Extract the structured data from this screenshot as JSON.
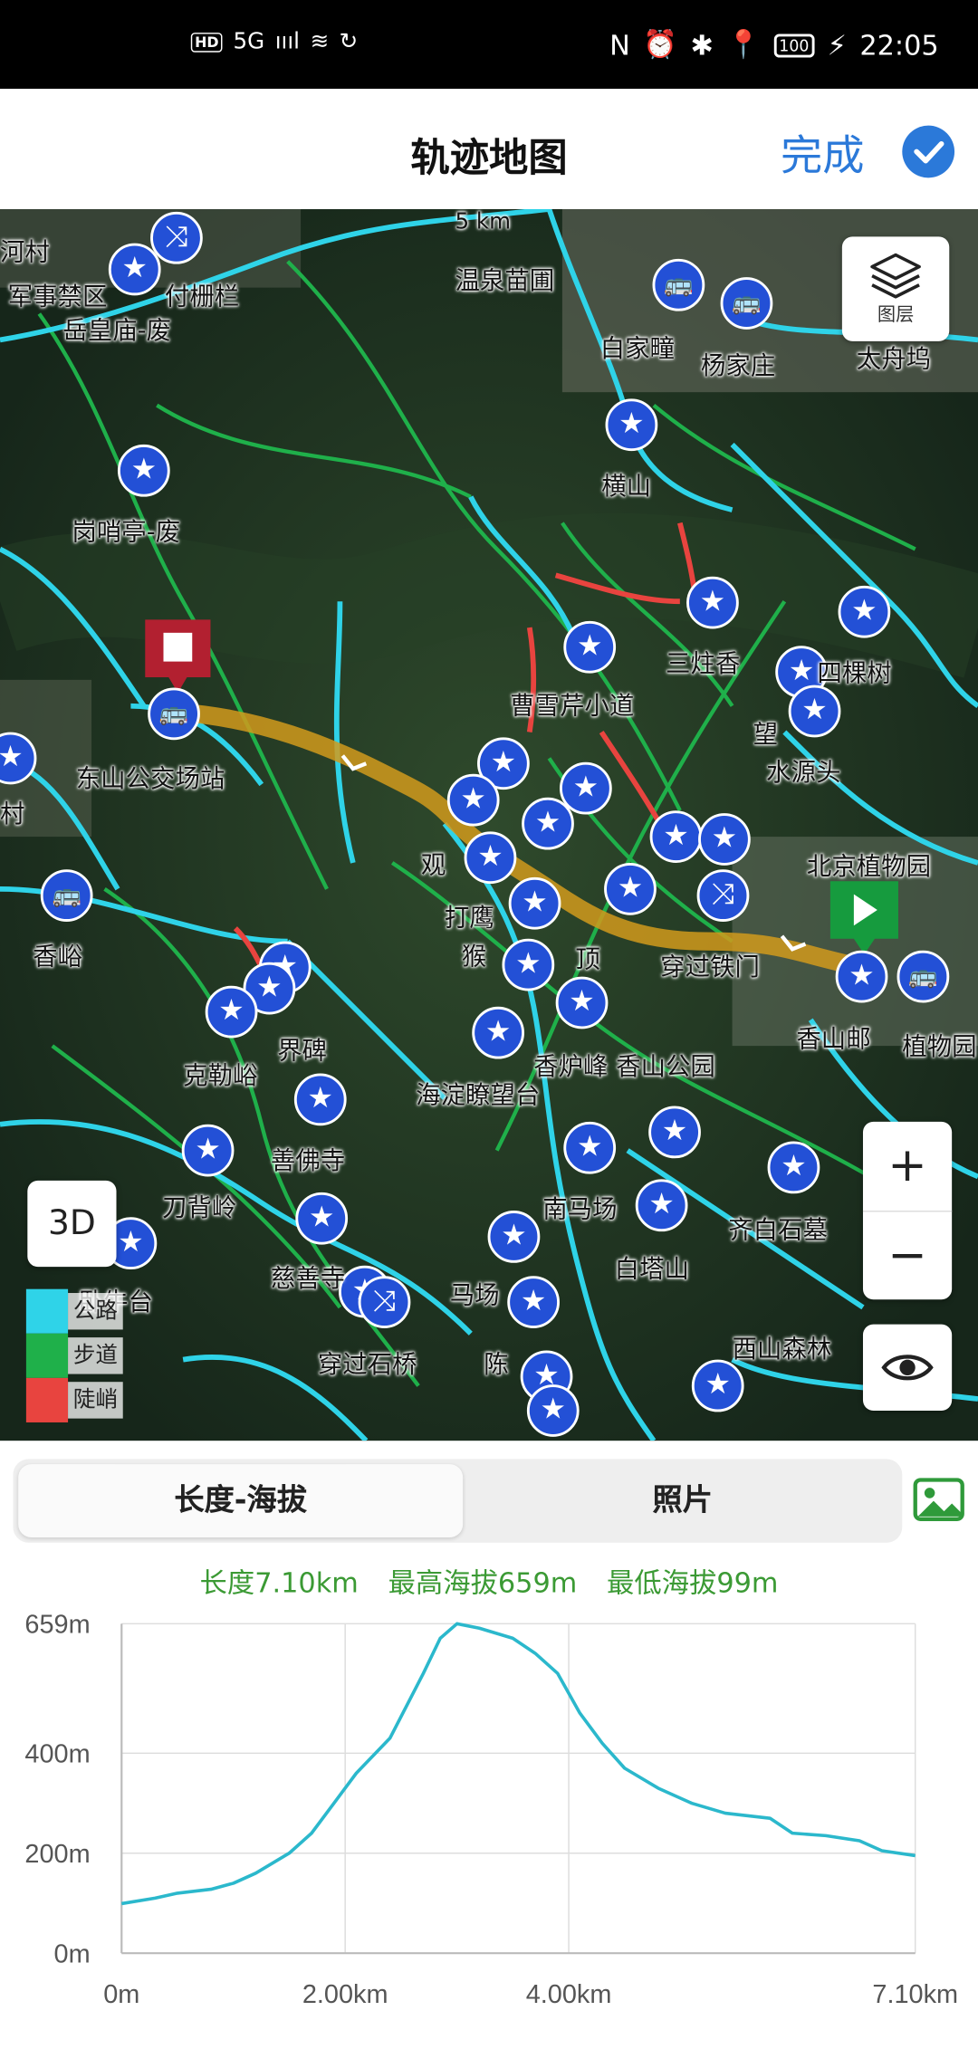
{
  "status": {
    "left": [
      "HD",
      "5G",
      "ıııl",
      "≋",
      "↻"
    ],
    "right_icons": [
      "N",
      "⏰",
      "✱",
      "📍"
    ],
    "battery": "100",
    "charging": "⚡",
    "time": "22:05"
  },
  "header": {
    "title": "轨迹地图",
    "done": "完成"
  },
  "map": {
    "scale": "5 km",
    "layers_label": "图层",
    "mode_3d": "3D",
    "zoom_in": "+",
    "zoom_out": "−",
    "labels": {
      "l1": "河村",
      "l2": "军事禁区",
      "l3": "付栅栏",
      "l4": "岳皇庙-废",
      "l5": "温泉苗圃",
      "l6": "白家疃",
      "l7": "杨家庄",
      "l8": "太舟坞",
      "l9": "横山",
      "l10": "岗哨亭-废",
      "l11": "三炷香",
      "l12": "四棵树",
      "l13": "曹雪芹小道",
      "l14": "望",
      "l15": "水源头",
      "l16": "东山公交场站",
      "l17": "北京植物园",
      "l18": "香峪",
      "l19": "观",
      "l20": "打鹰",
      "l21": "猴",
      "l22": "顶",
      "l23": "穿过铁门",
      "l24": "香山邮",
      "l25": "植物园",
      "l26": "界碑",
      "l27": "克勒峪",
      "l28": "香炉峰 香山公园",
      "l29": "海淀瞭望台",
      "l30": "善佛寺",
      "l31": "刀背岭",
      "l32": "南马场",
      "l33": "齐白石墓",
      "l34": "白塔山",
      "l35": "卧牛台",
      "l36": "慈善寺",
      "l37": "马场",
      "l38": "穿过石桥",
      "l39": "陈",
      "l40": "西山森林",
      "l41": "村"
    },
    "legend": [
      {
        "label": "公路",
        "color": "#2fd3e8"
      },
      {
        "label": "步道",
        "color": "#1fb04a"
      },
      {
        "label": "陡峭",
        "color": "#e8443f"
      }
    ]
  },
  "tabs": {
    "active": "长度-海拔",
    "other": "照片"
  },
  "stats": {
    "length": "长度7.10km",
    "max": "最高海拔659m",
    "min": "最低海拔99m"
  },
  "chart_data": {
    "type": "area",
    "xlabel": "",
    "ylabel": "",
    "x_ticks": [
      "0m",
      "2.00km",
      "4.00km",
      "7.10km"
    ],
    "y_ticks": [
      "0m",
      "200m",
      "400m",
      "659m"
    ],
    "xlim": [
      0,
      7.1
    ],
    "ylim": [
      0,
      659
    ],
    "color": "#2bb8cc",
    "x": [
      0,
      0.3,
      0.5,
      0.8,
      1.0,
      1.2,
      1.5,
      1.7,
      1.9,
      2.1,
      2.4,
      2.7,
      2.85,
      3.0,
      3.2,
      3.5,
      3.7,
      3.9,
      4.1,
      4.3,
      4.5,
      4.8,
      5.1,
      5.4,
      5.8,
      6.0,
      6.3,
      6.6,
      6.8,
      7.1
    ],
    "y": [
      99,
      110,
      120,
      128,
      140,
      160,
      200,
      240,
      300,
      360,
      430,
      560,
      630,
      659,
      650,
      630,
      600,
      560,
      480,
      420,
      370,
      330,
      300,
      280,
      270,
      240,
      235,
      225,
      205,
      195
    ]
  }
}
